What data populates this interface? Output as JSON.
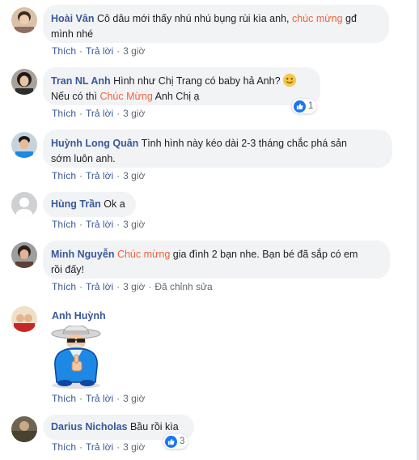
{
  "comments": [
    {
      "author": "Hoài Vân",
      "line1_pre": "Cô dâu mới thấy nhú nhú bụng rùi kìa anh, ",
      "mention": "chúc mừng",
      "line1_post": " gđ",
      "line2": "mình nhé",
      "like": "Thích",
      "reply": "Trả lời",
      "time": "3 giờ"
    },
    {
      "author": "Tran NL Anh",
      "line1_pre": "Hình như Chị Trang có baby hả Anh? ",
      "emoji": "smiling-face-icon",
      "line2_pre": "Nếu có thì ",
      "mention": "Chúc Mừng",
      "line2_post": " Anh Chị ạ",
      "like": "Thích",
      "reply": "Trả lời",
      "time": "3 giờ",
      "reaction_count": "1"
    },
    {
      "author": "Huỳnh Long Quân",
      "line1": "Tình hình này kéo dài 2-3 tháng chắc phá sản",
      "line2": "sớm luôn anh.",
      "like": "Thích",
      "reply": "Trả lời",
      "time": "3 giờ"
    },
    {
      "author": "Hùng Trần",
      "line1": "Ok a",
      "like": "Thích",
      "reply": "Trả lời",
      "time": "3 giờ"
    },
    {
      "author": "Minh Nguyễn",
      "mention": "Chúc mừng",
      "line1_post": " gia đình 2 bạn nhe. Bạn bé đã sắp có em",
      "line2": "rồi đấy!",
      "like": "Thích",
      "reply": "Trả lời",
      "time": "3 giờ",
      "edited": "Đã chỉnh sửa"
    },
    {
      "author": "Anh Huỳnh",
      "sticker": "old-man-thumbs-up-sticker",
      "like": "Thích",
      "reply": "Trả lời",
      "time": "3 giờ"
    },
    {
      "author": "Darius Nicholas",
      "line1": "Bầu rồi kìa",
      "like": "Thích",
      "reply": "Trả lời",
      "time": "3 giờ",
      "reaction_count": "3"
    }
  ],
  "colors": {
    "author": "#385898",
    "mention": "#f0643c",
    "bubble": "#f2f3f5",
    "like_blue": "#1877f2"
  }
}
